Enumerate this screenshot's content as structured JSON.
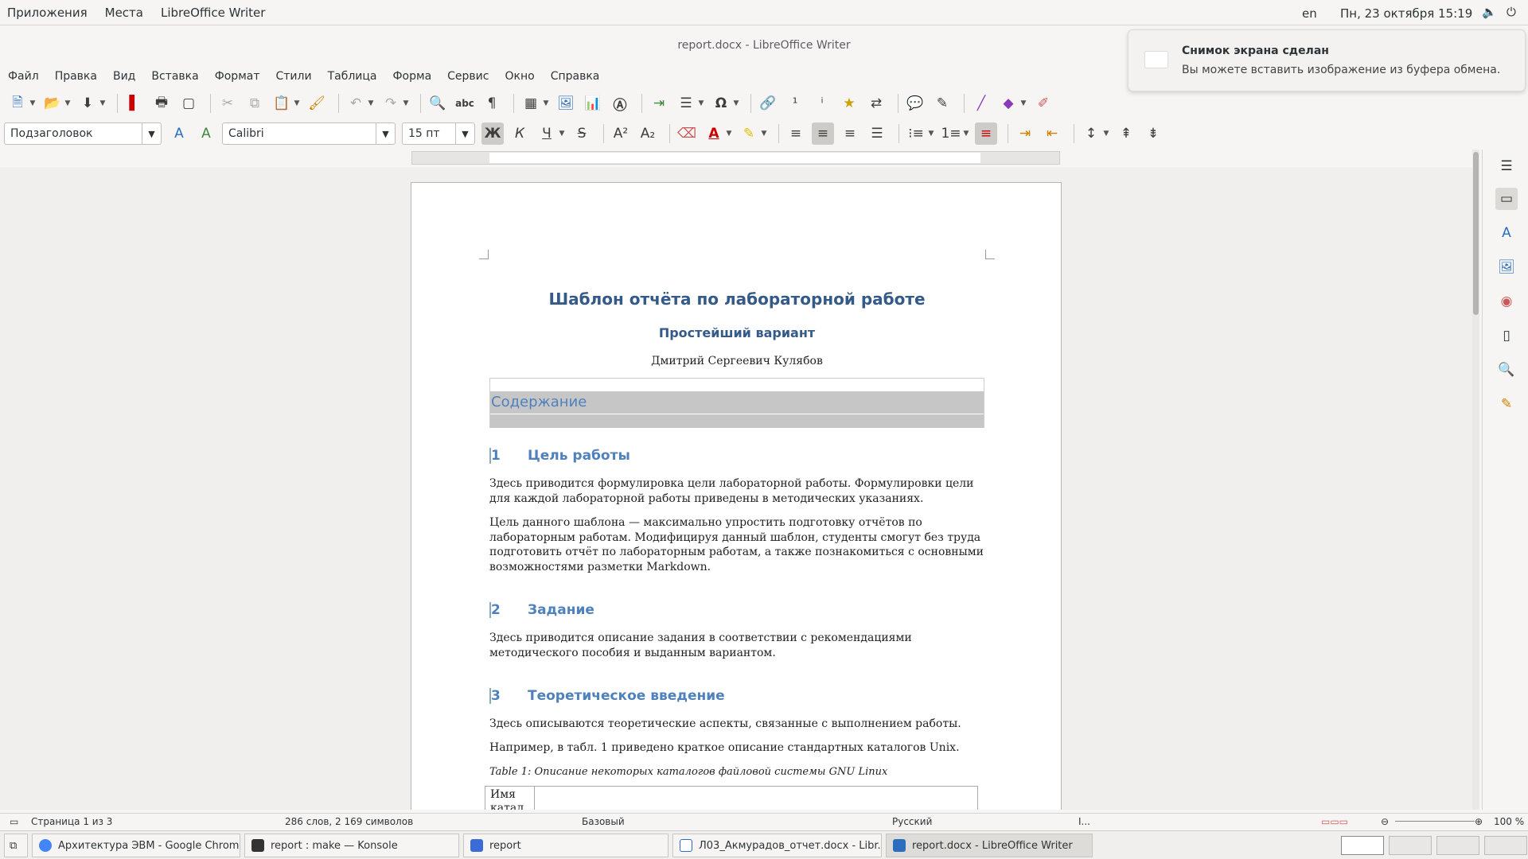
{
  "topbar": {
    "applications": "Приложения",
    "places": "Места",
    "app_name": "LibreOffice Writer",
    "lang": "en",
    "clock": "Пн, 23 октября  15:19",
    "volume_icon": "volume-icon",
    "power_icon": "power-icon"
  },
  "window": {
    "title": "report.docx - LibreOffice Writer"
  },
  "menu": [
    "Файл",
    "Правка",
    "Вид",
    "Вставка",
    "Формат",
    "Стили",
    "Таблица",
    "Форма",
    "Сервис",
    "Окно",
    "Справка"
  ],
  "format_bar": {
    "paragraph_style": "Подзаголовок",
    "font_name": "Calibri",
    "font_size": "15 пт"
  },
  "document": {
    "title": "Шаблон отчёта по лабораторной работе",
    "subtitle": "Простейший вариант",
    "author": "Дмитрий Сергеевич Кулябов",
    "toc_heading": "Содержание",
    "sections": [
      {
        "num": "1",
        "title": "Цель работы",
        "paras": [
          "Здесь приводится формулировка цели лабораторной работы. Формулировки цели для каждой лабораторной работы приведены в методических указаниях.",
          "Цель данного шаблона — максимально упростить подготовку отчётов по лабораторным работам. Модифицируя данный шаблон, студенты смогут без труда подготовить отчёт по лабораторным работам, а также познакомиться с основными возможностями разметки Markdown."
        ]
      },
      {
        "num": "2",
        "title": "Задание",
        "paras": [
          "Здесь приводится описание задания в соответствии с рекомендациями методического пособия и выданным вариантом."
        ]
      },
      {
        "num": "3",
        "title": "Теоретическое введение",
        "paras": [
          "Здесь описываются теоретические аспекты, связанные с выполнением работы.",
          "Например, в табл. 1 приведено краткое описание стандартных каталогов Unix."
        ]
      }
    ],
    "table_caption": "Table 1: Описание некоторых каталогов файловой системы GNU Linux",
    "table_first_cell": "Имя катал"
  },
  "notification": {
    "title": "Снимок экрана сделан",
    "body": "Вы можете вставить изображение из буфера обмена."
  },
  "status": {
    "page": "Страница 1 из 3",
    "words": "286 слов, 2 169 символов",
    "page_style": "Базовый",
    "language": "Русский",
    "zoom": "100 %"
  },
  "taskbar": {
    "tasks": [
      {
        "label": "Архитектура ЭВМ - Google Chrome",
        "icon": "chrome-icon",
        "color": "#4285f4"
      },
      {
        "label": "report : make — Konsole",
        "icon": "terminal-icon",
        "color": "#333333"
      },
      {
        "label": "report",
        "icon": "folder-icon",
        "color": "#3b6cd6"
      },
      {
        "label": "Л03_Акмурадов_отчет.docx - Libr...",
        "icon": "writer-icon",
        "color": "#2a6ebd"
      },
      {
        "label": "report.docx - LibreOffice Writer",
        "icon": "writer-icon",
        "color": "#2a6ebd"
      }
    ]
  },
  "colors": {
    "heading": "#345a8a",
    "section": "#4f81bd"
  }
}
